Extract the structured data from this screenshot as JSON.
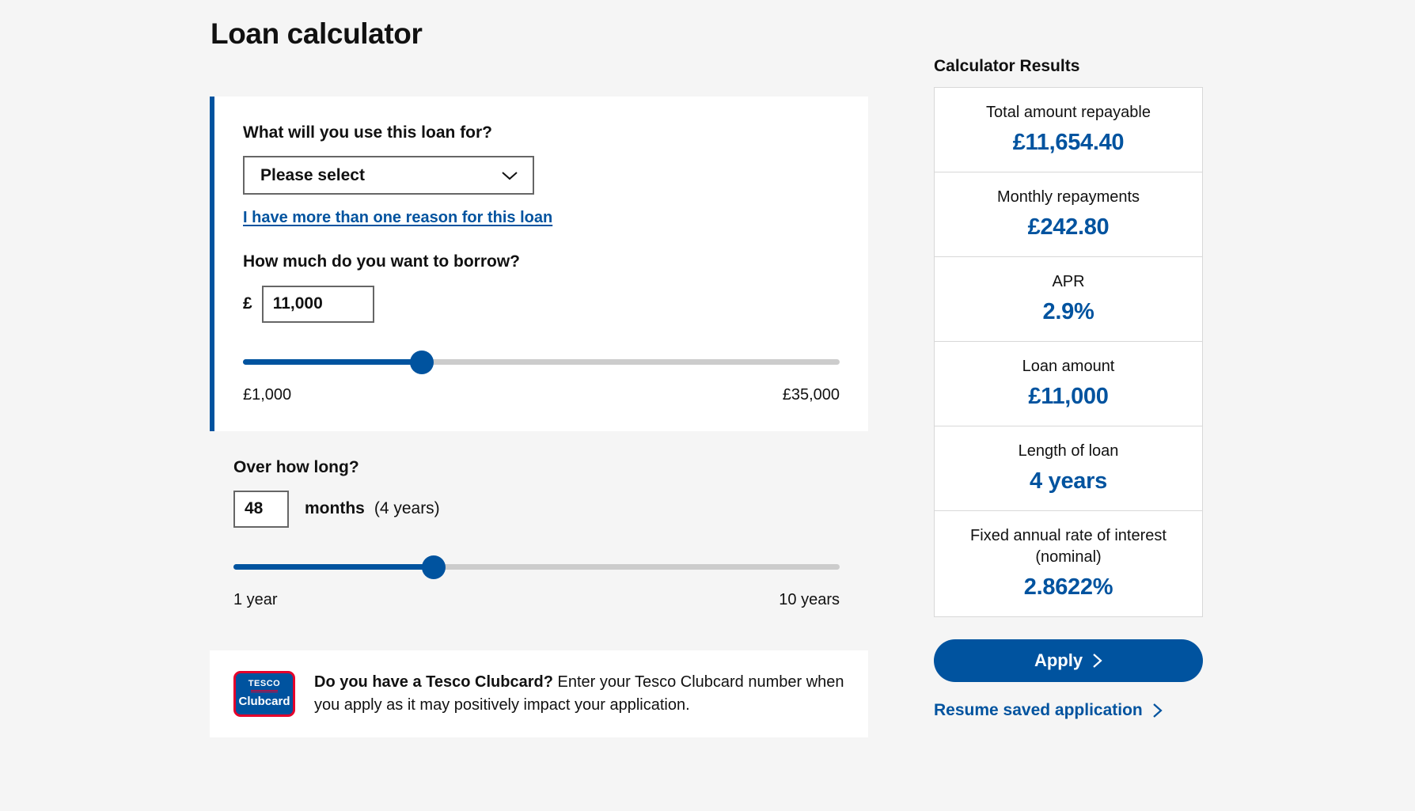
{
  "page": {
    "title": "Loan calculator"
  },
  "form": {
    "purpose": {
      "label": "What will you use this loan for?",
      "selected_option": "Please select",
      "chevron_icon": "chevron-down-icon",
      "multi_reason_link": "I have more than one reason for this loan"
    },
    "amount": {
      "label": "How much do you want to borrow?",
      "currency_symbol": "£",
      "value": "11,000",
      "slider_min_label": "£1,000",
      "slider_max_label": "£35,000",
      "slider_min": 1000,
      "slider_max": 35000,
      "slider_value": 11000,
      "slider_fill_percent": 30
    },
    "term": {
      "label": "Over how long?",
      "value": "48",
      "units": "months",
      "years_note": "(4 years)",
      "slider_min_label": "1 year",
      "slider_max_label": "10 years",
      "slider_min": 12,
      "slider_max": 120,
      "slider_value": 48,
      "slider_fill_percent": 33
    },
    "clubcard_banner": {
      "logo_top_text": "TESCO",
      "logo_bottom_text": "Clubcard",
      "heading": "Do you have a Tesco Clubcard?",
      "body": " Enter your Tesco Clubcard number when you apply as it may positively impact your application."
    }
  },
  "results": {
    "heading": "Calculator Results",
    "rows": [
      {
        "label": "Total amount repayable",
        "value": "£11,654.40"
      },
      {
        "label": "Monthly repayments",
        "value": "£242.80"
      },
      {
        "label": "APR",
        "value": "2.9%"
      },
      {
        "label": "Loan amount",
        "value": "£11,000"
      },
      {
        "label": "Length of loan",
        "value": "4 years"
      },
      {
        "label": "Fixed annual rate of interest (nominal)",
        "value": "2.8622%"
      }
    ],
    "apply_label": "Apply",
    "apply_chevron_icon": "chevron-right-icon",
    "resume_label": "Resume saved application",
    "resume_chevron_icon": "chevron-right-icon"
  },
  "colors": {
    "brand_blue": "#00539F",
    "clubcard_red": "#E4002B",
    "page_background": "#f5f5f5"
  }
}
